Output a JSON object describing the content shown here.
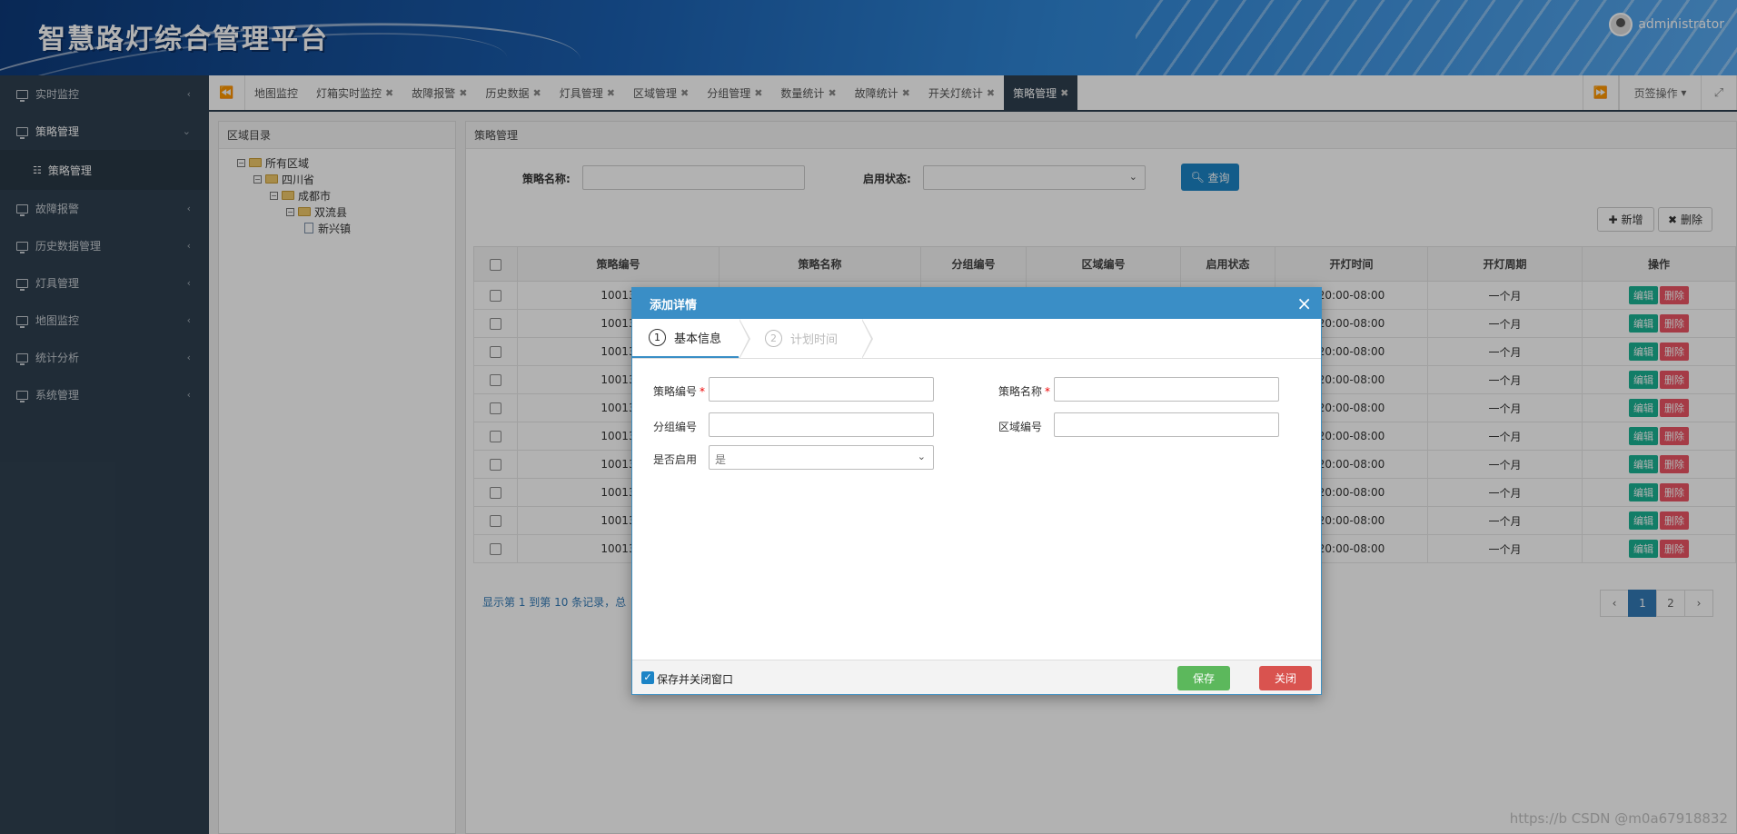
{
  "header": {
    "title": "智慧路灯综合管理平台",
    "user": "administrator"
  },
  "sidebar": {
    "items": [
      {
        "label": "实时监控"
      },
      {
        "label": "策略管理"
      },
      {
        "label": "策略管理"
      },
      {
        "label": "故障报警"
      },
      {
        "label": "历史数据管理"
      },
      {
        "label": "灯具管理"
      },
      {
        "label": "地图监控"
      },
      {
        "label": "统计分析"
      },
      {
        "label": "系统管理"
      }
    ]
  },
  "tabs": [
    {
      "label": "地图监控"
    },
    {
      "label": "灯箱实时监控"
    },
    {
      "label": "故障报警"
    },
    {
      "label": "历史数据"
    },
    {
      "label": "灯具管理"
    },
    {
      "label": "区域管理"
    },
    {
      "label": "分组管理"
    },
    {
      "label": "数量统计"
    },
    {
      "label": "故障统计"
    },
    {
      "label": "开关灯统计"
    },
    {
      "label": "策略管理"
    }
  ],
  "tab_ops": "页签操作",
  "left_panel": {
    "title": "区域目录",
    "tree": [
      "所有区域",
      "四川省",
      "成都市",
      "双流县",
      "新兴镇"
    ]
  },
  "main_panel": {
    "title": "策略管理",
    "search": {
      "name_label": "策略名称:",
      "status_label": "启用状态:",
      "query_button": "查询"
    },
    "add_button": "新增",
    "delete_button": "删除",
    "columns": [
      "策略编号",
      "策略名称",
      "分组编号",
      "区域编号",
      "启用状态",
      "开灯时间",
      "开灯周期",
      "操作"
    ],
    "rows": [
      {
        "id": "10013",
        "time": "20:00-08:00",
        "cycle": "一个月"
      },
      {
        "id": "10013",
        "time": "20:00-08:00",
        "cycle": "一个月"
      },
      {
        "id": "10013",
        "time": "20:00-08:00",
        "cycle": "一个月"
      },
      {
        "id": "10013",
        "time": "20:00-08:00",
        "cycle": "一个月"
      },
      {
        "id": "10013",
        "time": "20:00-08:00",
        "cycle": "一个月"
      },
      {
        "id": "10013",
        "time": "20:00-08:00",
        "cycle": "一个月"
      },
      {
        "id": "10013",
        "time": "20:00-08:00",
        "cycle": "一个月"
      },
      {
        "id": "10013",
        "time": "20:00-08:00",
        "cycle": "一个月"
      },
      {
        "id": "10013",
        "time": "20:00-08:00",
        "cycle": "一个月"
      },
      {
        "id": "10013",
        "time": "20:00-08:00",
        "cycle": "一个月"
      }
    ],
    "edit_label": "编辑",
    "delete_label": "删除",
    "pager_info": "显示第 1 到第 10 条记录，总",
    "pages": [
      "‹",
      "1",
      "2",
      "›"
    ]
  },
  "modal": {
    "title": "添加详情",
    "steps": [
      {
        "num": "1",
        "label": "基本信息"
      },
      {
        "num": "2",
        "label": "计划时间"
      }
    ],
    "fields": {
      "policy_id": "策略编号",
      "policy_name": "策略名称",
      "group_id": "分组编号",
      "area_id": "区域编号",
      "enabled": "是否启用",
      "enabled_value": "是"
    },
    "save_close_label": "保存并关闭窗口",
    "save_button": "保存",
    "close_button": "关闭"
  },
  "watermark": "https://b CSDN @m0a67918832"
}
